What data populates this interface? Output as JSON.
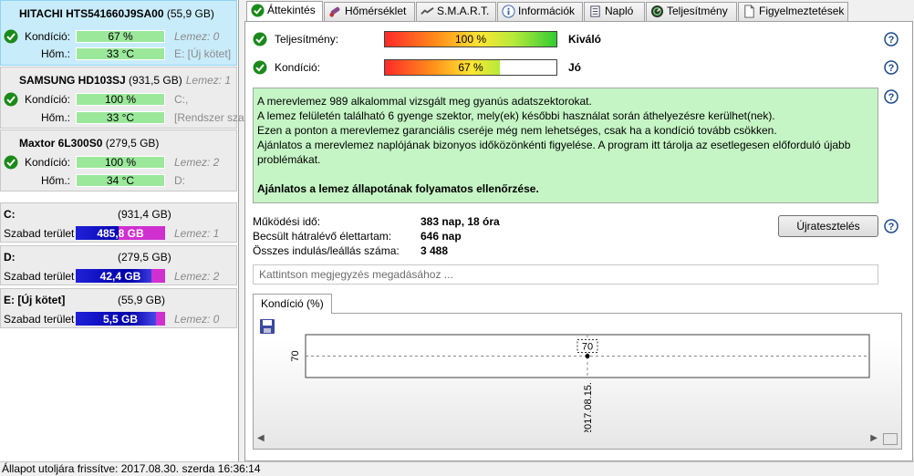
{
  "disks": [
    {
      "name": "HITACHI HTS541660J9SA00",
      "size": "(55,9 GB)",
      "lemez": "",
      "condition_label": "Kondíció:",
      "condition_value": "67 %",
      "temp_label": "Hőm.:",
      "temp_value": "33 °C",
      "extra1": "Lemez: 0",
      "extra2": "E: [Új kötet]"
    },
    {
      "name": "SAMSUNG HD103SJ",
      "size": "(931,5 GB)",
      "lemez": "Lemez: 1",
      "condition_label": "Kondíció:",
      "condition_value": "100 %",
      "temp_label": "Hőm.:",
      "temp_value": "33 °C",
      "extra1": "C:,",
      "extra2": "[Rendszer sza"
    },
    {
      "name": "Maxtor 6L300S0",
      "size": "(279,5 GB)",
      "lemez": "",
      "condition_label": "Kondíció:",
      "condition_value": "100 %",
      "temp_label": "Hőm.:",
      "temp_value": "34 °C",
      "extra1": "Lemez: 2",
      "extra2": "D:"
    }
  ],
  "volumes": [
    {
      "name": "C:",
      "size": "(931,4 GB)",
      "free_label": "Szabad terület",
      "free": "485,8 GB",
      "lemez": "Lemez: 1",
      "used_fraction": 0.52
    },
    {
      "name": "D:",
      "size": "(279,5 GB)",
      "free_label": "Szabad terület",
      "free": "42,4 GB",
      "lemez": "Lemez: 2",
      "used_fraction": 0.15
    },
    {
      "name": "E: [Új kötet]",
      "size": "(55,9 GB)",
      "free_label": "Szabad terület",
      "free": "5,5 GB",
      "lemez": "Lemez: 0",
      "used_fraction": 0.1
    }
  ],
  "tabs": [
    {
      "label": "Áttekintés",
      "icon": "check-icon",
      "active": true
    },
    {
      "label": "Hőmérséklet",
      "icon": "thermometer-icon",
      "active": false
    },
    {
      "label": "S.M.A.R.T.",
      "icon": "smart-icon",
      "active": false
    },
    {
      "label": "Információk",
      "icon": "info-icon",
      "active": false
    },
    {
      "label": "Napló",
      "icon": "log-icon",
      "active": false
    },
    {
      "label": "Teljesítmény",
      "icon": "gauge-icon",
      "active": false
    },
    {
      "label": "Figyelmeztetések",
      "icon": "document-icon",
      "active": false
    }
  ],
  "overview": {
    "performance_label": "Teljesítmény:",
    "performance_value": "100 %",
    "performance_fraction": 1.0,
    "performance_grade": "Kiváló",
    "condition_label": "Kondíció:",
    "condition_value": "67 %",
    "condition_fraction": 0.67,
    "condition_grade": "Jó",
    "messages": [
      "A merevlemez 989 alkalommal vizsgált meg gyanús adatszektorokat.",
      "A lemez felületén található 6 gyenge szektor, mely(ek) későbbi használat során áthelyezésre kerülhet(nek).",
      "Ezen a ponton a merevlemez garanciális cseréje még nem lehetséges, csak ha a kondíció tovább csökken.",
      "Ajánlatos a merevlemez naplójának bizonyos időközönkénti figyelése. A program itt tárolja az esetlegesen előforduló újabb problémákat."
    ],
    "recommendation": "Ajánlatos a lemez állapotának folyamatos ellenőrzése.",
    "uptime_label": "Működési idő:",
    "uptime_value": "383 nap, 18 óra",
    "remaining_label": "Becsült hátralévő élettartam:",
    "remaining_value": "646 nap",
    "startstop_label": "Összes indulás/leállás száma:",
    "startstop_value": "3 488",
    "retest_label": "Újratesztelés",
    "note_placeholder": "Kattintson megjegyzés megadásához ...",
    "chart_tab_label": "Kondíció  (%)"
  },
  "chart_data": {
    "type": "line",
    "x": [
      "2017.08.15."
    ],
    "series": [
      {
        "values": [
          70
        ]
      }
    ],
    "data_labels": [
      "70"
    ],
    "y_tick_labels": [
      "70"
    ],
    "x_tick_labels": [
      "2017.08.15."
    ]
  },
  "status": "Állapot utoljára frissítve: 2017.08.30. szerda 16:36:14",
  "colors": {
    "accent_green": "#9be89b",
    "message_bg": "#c5f5c5",
    "selected_disk": "#c9ecfb"
  }
}
